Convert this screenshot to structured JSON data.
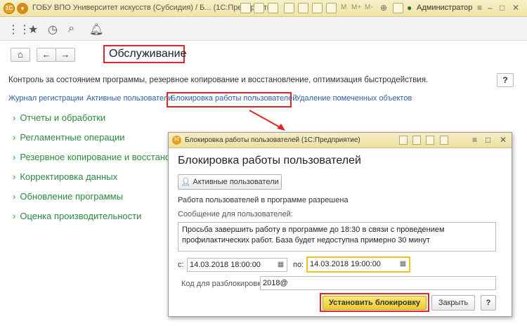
{
  "app": {
    "logo_text": "1С",
    "title": "ГОБУ ВПО Университет искусств (Субсидия) / Б...  (1С:Предприятие)",
    "user": "Администратор",
    "toolbar_labels": [
      "M",
      "M+",
      "M-"
    ]
  },
  "page": {
    "title": "Обслуживание",
    "description": "Контроль за состоянием программы, резервное копирование и восстановление, оптимизация быстродействия.",
    "help_label": "?",
    "links": [
      "Журнал регистрации",
      "Активные пользователи",
      "Блокировка работы пользователей",
      "Удаление помеченных объектов"
    ],
    "sections": [
      "Отчеты и обработки",
      "Регламентные операции",
      "Резервное копирование и восстано",
      "Корректировка данных",
      "Обновление программы",
      "Оценка производительности"
    ]
  },
  "dialog": {
    "logo_text": "1С",
    "title": "Блокировка работы пользователей  (1С:Предприятие)",
    "heading": "Блокировка работы пользователей",
    "active_users_button": "Активные пользователи",
    "status_text": "Работа пользователей в программе разрешена",
    "message_label": "Сообщение для пользователей:",
    "message_value": "Просьба завершить работу в программе до 18:30 в связи с проведением профилактических работ. База будет недоступна примерно 30 минут",
    "from_label": "с:",
    "from_value": "14.03.2018 18:00:00",
    "to_label": "по:",
    "to_value": "14.03.2018 19:00:00",
    "unlock_code_label": "Код для разблокировки:",
    "unlock_code_value": "2018@",
    "set_lock_button": "Установить блокировку",
    "close_button": "Закрыть",
    "help_button": "?"
  },
  "colors": {
    "highlight_red": "#e0262a",
    "link_blue": "#2a5ea8",
    "section_green": "#2c8a3e",
    "primary_button_yellow": "#f1cc2c",
    "titlebar_yellow": "#efe4a6"
  }
}
